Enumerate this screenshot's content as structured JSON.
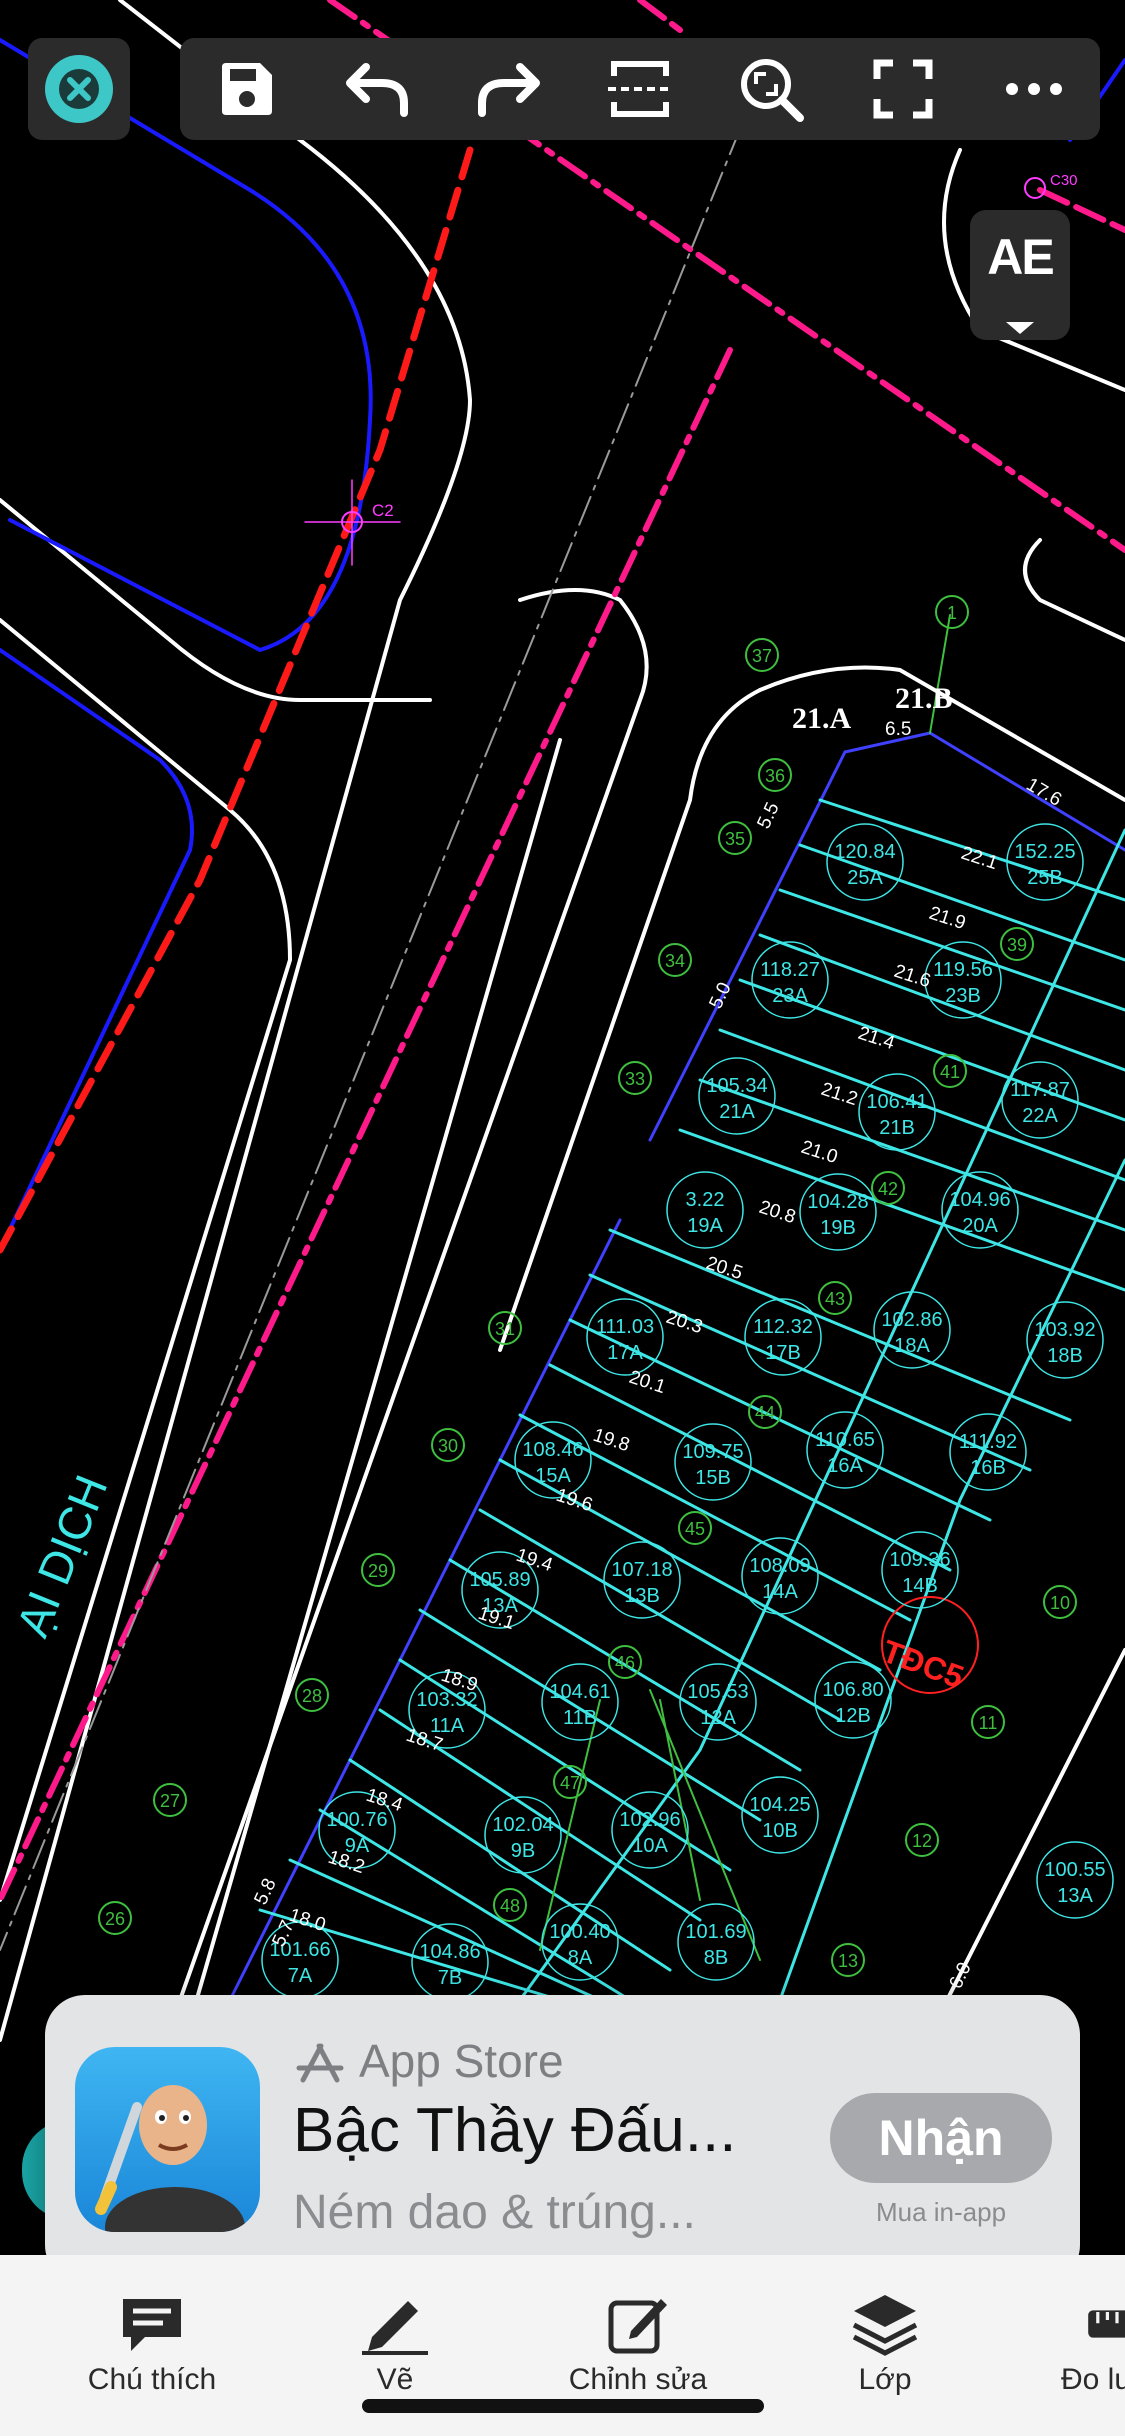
{
  "toolbar": {
    "close_icon": "close-icon",
    "tools": [
      {
        "name": "save",
        "icon": "save-icon"
      },
      {
        "name": "undo",
        "icon": "undo-icon"
      },
      {
        "name": "redo",
        "icon": "redo-icon"
      },
      {
        "name": "section",
        "icon": "section-icon"
      },
      {
        "name": "zoom",
        "icon": "zoom-icon"
      },
      {
        "name": "fullscreen",
        "icon": "fullscreen-icon"
      },
      {
        "name": "more",
        "icon": "more-icon"
      }
    ],
    "text_style_label": "AE"
  },
  "drawing": {
    "road_label": "ẠI DỊCH",
    "marker_c2": "C2",
    "marker_c30": "C30",
    "corner_labels": [
      "21.A",
      "21.B"
    ],
    "tdc_label": "TĐC5",
    "lots": [
      {
        "area": "120.84",
        "id": "25A"
      },
      {
        "area": "152.25",
        "id": "25B"
      },
      {
        "area": "118.27",
        "id": "23A"
      },
      {
        "area": "119.56",
        "id": "23B"
      },
      {
        "area": "105.34",
        "id": "21A"
      },
      {
        "area": "106.41",
        "id": "21B"
      },
      {
        "area": "117.87",
        "id": "22A"
      },
      {
        "area": "3.22",
        "id": "19A"
      },
      {
        "area": "104.28",
        "id": "19B"
      },
      {
        "area": "104.96",
        "id": "20A"
      },
      {
        "area": "111.03",
        "id": "17A"
      },
      {
        "area": "112.32",
        "id": "17B"
      },
      {
        "area": "102.86",
        "id": "18A"
      },
      {
        "area": "103.92",
        "id": "18B"
      },
      {
        "area": "108.46",
        "id": "15A"
      },
      {
        "area": "109.75",
        "id": "15B"
      },
      {
        "area": "110.65",
        "id": "16A"
      },
      {
        "area": "111.92",
        "id": "16B"
      },
      {
        "area": "105.89",
        "id": "13A"
      },
      {
        "area": "107.18",
        "id": "13B"
      },
      {
        "area": "108.09",
        "id": "14A"
      },
      {
        "area": "109.36",
        "id": "14B"
      },
      {
        "area": "103.32",
        "id": "11A"
      },
      {
        "area": "104.61",
        "id": "11B"
      },
      {
        "area": "105.53",
        "id": "12A"
      },
      {
        "area": "106.80",
        "id": "12B"
      },
      {
        "area": "100.76",
        "id": "9A"
      },
      {
        "area": "102.04",
        "id": "9B"
      },
      {
        "area": "102.96",
        "id": "10A"
      },
      {
        "area": "104.25",
        "id": "10B"
      },
      {
        "area": "101.66",
        "id": "7A"
      },
      {
        "area": "104.86",
        "id": "7B"
      },
      {
        "area": "100.40",
        "id": "8A"
      },
      {
        "area": "101.69",
        "id": "8B"
      },
      {
        "area": "100.55",
        "id": "13A"
      }
    ],
    "green_markers": [
      "1",
      "26",
      "27",
      "28",
      "29",
      "30",
      "31",
      "33",
      "34",
      "35",
      "36",
      "37",
      "39",
      "41",
      "42",
      "43",
      "44",
      "45",
      "46",
      "47",
      "48",
      "10",
      "11",
      "12",
      "13"
    ],
    "dimensions": [
      "6.5",
      "17.6",
      "22.1",
      "21.9",
      "21.6",
      "21.4",
      "21.2",
      "21.0",
      "20.8",
      "20.5",
      "20.3",
      "20.1",
      "19.8",
      "19.6",
      "19.4",
      "19.1",
      "18.9",
      "18.7",
      "18.4",
      "18.2",
      "18.0",
      "5.5",
      "5.0",
      "6.0",
      "5.7",
      "5.8"
    ]
  },
  "app_banner": {
    "store_label": "App Store",
    "title": "Bậc Thầy Đấu...",
    "subtitle": "Ném dao & trúng...",
    "get_button": "Nhận",
    "in_app_note": "Mua in-app"
  },
  "bottom_tabs": [
    {
      "label": "Chú thích",
      "icon": "comment-icon"
    },
    {
      "label": "Vẽ",
      "icon": "pencil-icon"
    },
    {
      "label": "Chỉnh sửa",
      "icon": "edit-icon"
    },
    {
      "label": "Lớp",
      "icon": "layers-icon"
    },
    {
      "label": "Đo lư",
      "icon": "ruler-icon"
    }
  ]
}
